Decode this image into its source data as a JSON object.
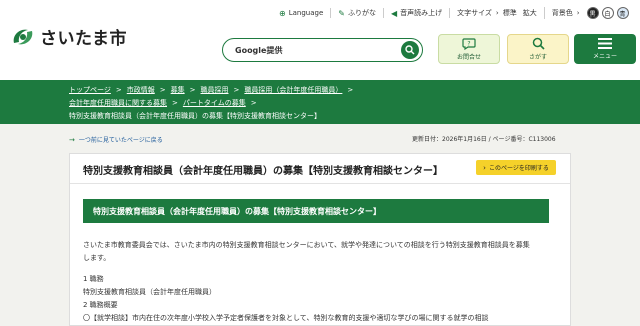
{
  "header": {
    "logo_text": "さいたま市",
    "util": {
      "language": "Language",
      "furigana": "ふりがな",
      "read_aloud": "音声読み上げ",
      "text_size_label": "文字サイズ",
      "text_size_standard": "標準",
      "text_size_large": "拡大",
      "bg_color_label": "背景色",
      "bg_options": [
        "黒",
        "白",
        "青"
      ]
    },
    "search": {
      "label": "Google提供"
    },
    "quick": {
      "inquiry": "お問合せ",
      "find": "さがす",
      "menu": "メニュー"
    }
  },
  "breadcrumb": {
    "line1": [
      "トップページ",
      "市政情報",
      "募集",
      "職員採用",
      "職員採用（会計年度任用職員）"
    ],
    "line2": [
      "会計年度任用職員に関する募集",
      "パートタイムの募集"
    ],
    "current": "特別支援教育相談員（会計年度任用職員）の募集【特別支援教育相談センター】"
  },
  "subbar": {
    "back": "一つ前に見ていたページに戻る",
    "updated": "更新日付：2026年1月16日 / ページ番号：C113006"
  },
  "main": {
    "title": "特別支援教育相談員（会計年度任用職員）の募集【特別支援教育相談センター】",
    "print": "このページを印刷する",
    "section_heading": "特別支援教育相談員（会計年度任用職員）の募集【特別支援教育相談センター】",
    "intro_1": "さいたま市教育委員会では、さいたま市内の特別支援教育相談センターにおいて、就学や発達についての相談を行う特別支援教育相談員を募集",
    "intro_2": "します。",
    "item1_heading": "1 職務",
    "item1_body": "特別支援教育相談員（会計年度任用職員）",
    "item2_heading": "2 職務概要",
    "item2_body": "〇【就学相談】市内在住の次年度小学校入学予定者保護者を対象として、特別な教育的支援や適切な学びの場に関する就学の相談"
  }
}
